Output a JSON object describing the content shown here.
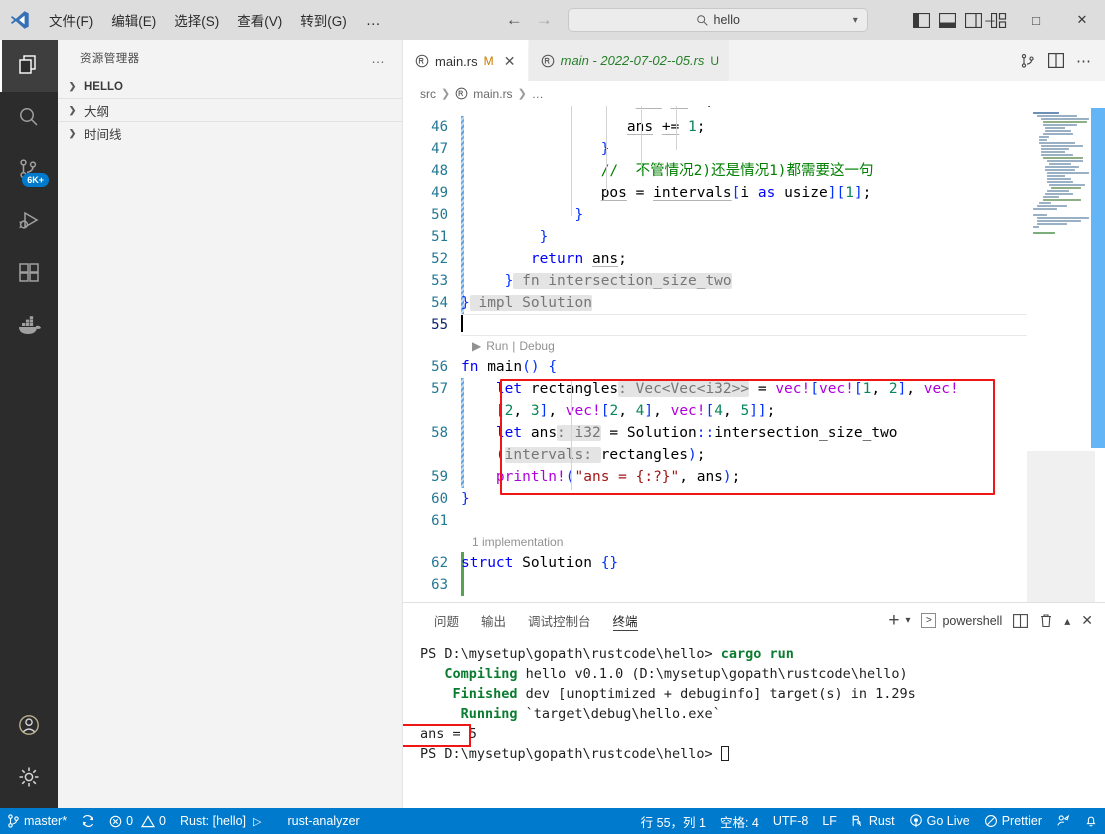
{
  "titlebar": {
    "logo_icon": "vscode-logo-icon",
    "menus": [
      {
        "label": "文件(F)"
      },
      {
        "label": "编辑(E)"
      },
      {
        "label": "选择(S)"
      },
      {
        "label": "查看(V)"
      },
      {
        "label": "转到(G)"
      }
    ],
    "more_label": "…",
    "back_icon": "arrow-left-icon",
    "forward_icon": "arrow-right-icon",
    "quickopen": {
      "search_icon": "search-icon",
      "value": "hello",
      "chevron_icon": "chevron-down-icon"
    },
    "layout_icons": [
      "toggle-primary-sidebar-icon",
      "toggle-panel-icon",
      "toggle-secondary-sidebar-icon",
      "customize-layout-icon"
    ],
    "window_controls": {
      "minimize": "─",
      "maximize": "□",
      "close": "✕"
    }
  },
  "activitybar": {
    "items": [
      {
        "name": "explorer",
        "icon": "files-icon",
        "active": true,
        "badge": ""
      },
      {
        "name": "search",
        "icon": "search-icon",
        "active": false,
        "badge": ""
      },
      {
        "name": "source-control",
        "icon": "source-control-icon",
        "active": false,
        "badge": "6K+"
      },
      {
        "name": "run-and-debug",
        "icon": "run-debug-icon",
        "active": false,
        "badge": ""
      },
      {
        "name": "extensions",
        "icon": "extensions-icon",
        "active": false,
        "badge": ""
      },
      {
        "name": "docker",
        "icon": "docker-icon",
        "active": false,
        "badge": ""
      }
    ],
    "bottom": [
      {
        "name": "accounts",
        "icon": "account-icon"
      },
      {
        "name": "manage",
        "icon": "gear-icon"
      }
    ]
  },
  "sidebar": {
    "title": "资源管理器",
    "more_icon": "ellipsis-icon",
    "sections": [
      {
        "label": "HELLO",
        "expanded": false,
        "bold": true
      },
      {
        "label": "大纲",
        "expanded": false,
        "bold": false
      },
      {
        "label": "时间线",
        "expanded": false,
        "bold": false
      }
    ]
  },
  "editor": {
    "tabs": [
      {
        "label": "main.rs",
        "badge": "M",
        "active": true,
        "preview": false,
        "icon": "rust-file-icon",
        "close_icon": "✕"
      },
      {
        "label": "main - 2022-07-02--05.rs",
        "badge": "U",
        "active": false,
        "preview": true,
        "icon": "rust-file-icon",
        "close_icon": ""
      }
    ],
    "tab_actions": [
      "split-in-group-icon",
      "split-editor-icon",
      "more-actions-icon"
    ],
    "breadcrumb": [
      "src",
      "main.rs",
      "…"
    ],
    "breadcrumb_file_icon": "rust-file-icon",
    "codelens": {
      "implementation": "1 implementation",
      "run": "Run",
      "separator": "|",
      "debug": "Debug",
      "play_icon": "play-icon"
    },
    "lines": [
      {
        "n": "46",
        "indent": 8,
        "text": "ans += 1;"
      },
      {
        "n": "47",
        "indent": 6,
        "text": "}"
      },
      {
        "n": "48",
        "indent": 6,
        "text": "//  不管情况2)还是情况1)都需要这一句"
      },
      {
        "n": "49",
        "indent": 6,
        "text": "pos = intervals[i as usize][1];"
      },
      {
        "n": "50",
        "indent": 5,
        "text": "}"
      },
      {
        "n": "51",
        "indent": 4,
        "text": "}"
      },
      {
        "n": "52",
        "indent": 3,
        "text": "return ans;"
      },
      {
        "n": "53",
        "indent": 2,
        "text": "} fn intersection_size_two"
      },
      {
        "n": "54",
        "indent": 0,
        "text": "} impl Solution"
      },
      {
        "n": "55",
        "indent": 0,
        "text": ""
      },
      {
        "n": "56",
        "indent": 0,
        "text": "fn main() {"
      },
      {
        "n": "57",
        "indent": 1,
        "text": "let rectangles: Vec<Vec<i32>> = vec![vec![1, 2], vec![2, 3], vec![2, 4], vec![4, 5]];"
      },
      {
        "n": "58",
        "indent": 1,
        "text": "let ans: i32 = Solution::intersection_size_two(intervals: rectangles);"
      },
      {
        "n": "59",
        "indent": 1,
        "text": "println!(\"ans = {:?}\", ans);"
      },
      {
        "n": "60",
        "indent": 0,
        "text": "}"
      },
      {
        "n": "61",
        "indent": 0,
        "text": ""
      },
      {
        "n": "62",
        "indent": 0,
        "text": "struct Solution {}"
      },
      {
        "n": "63",
        "indent": 0,
        "text": ""
      }
    ]
  },
  "panel": {
    "tabs": [
      {
        "label": "问题",
        "active": false
      },
      {
        "label": "输出",
        "active": false
      },
      {
        "label": "调试控制台",
        "active": false
      },
      {
        "label": "终端",
        "active": true
      }
    ],
    "actions": {
      "new_terminal_icon": "plus-icon",
      "new_terminal_dropdown_icon": "chevron-down-icon",
      "shell_icon": "terminal-icon",
      "shell_name": "powershell",
      "split_icon": "split-terminal-icon",
      "kill_icon": "trash-icon",
      "maximize_icon": "chevron-up-icon",
      "close_icon": "close-icon"
    },
    "terminal": {
      "lines": [
        {
          "type": "prompt",
          "prompt": "PS D:\\mysetup\\gopath\\rustcode\\hello>",
          "cmd": " cargo run"
        },
        {
          "type": "status",
          "indent": "   ",
          "label": "Compiling",
          "rest": " hello v0.1.0 (D:\\mysetup\\gopath\\rustcode\\hello)"
        },
        {
          "type": "status",
          "indent": "    ",
          "label": "Finished",
          "rest": " dev [unoptimized + debuginfo] target(s) in 1.29s"
        },
        {
          "type": "status",
          "indent": "     ",
          "label": "Running",
          "rest": " `target\\debug\\hello.exe`"
        },
        {
          "type": "out",
          "text": "ans = 5",
          "highlighted": true
        },
        {
          "type": "prompt",
          "prompt": "PS D:\\mysetup\\gopath\\rustcode\\hello>",
          "cmd": " ",
          "cursor": true
        }
      ]
    }
  },
  "statusbar": {
    "left": [
      {
        "name": "remote-branch",
        "icon": "git-branch-icon",
        "label": "master*"
      },
      {
        "name": "sync",
        "icon": "sync-icon",
        "label": ""
      },
      {
        "name": "problems",
        "icon": "error-warning-icon",
        "label": "0",
        "label2": "0"
      },
      {
        "name": "rust-target",
        "icon": "",
        "label": "Rust: [hello]",
        "trailing_icon": "play-icon"
      },
      {
        "name": "rust-analyzer",
        "icon": "",
        "label": "rust-analyzer"
      }
    ],
    "right": [
      {
        "name": "cursor-position",
        "label": "行 55，列 1"
      },
      {
        "name": "indentation",
        "label": "空格: 4"
      },
      {
        "name": "encoding",
        "label": "UTF-8"
      },
      {
        "name": "eol",
        "label": "LF"
      },
      {
        "name": "language-mode",
        "icon": "rust-lang-icon",
        "label": "Rust"
      },
      {
        "name": "go-live",
        "icon": "broadcast-icon",
        "label": "Go Live"
      },
      {
        "name": "prettier",
        "icon": "prettier-icon",
        "label": "Prettier"
      },
      {
        "name": "feedback",
        "icon": "feedback-icon",
        "label": ""
      },
      {
        "name": "notifications",
        "icon": "bell-icon",
        "label": ""
      }
    ]
  },
  "colors": {
    "accent": "#007acc",
    "titlebar_bg": "#dddddd",
    "sidebar_bg": "#f3f3f3",
    "activitybar_bg": "#2c2c2c",
    "editor_bg": "#ffffff",
    "highlight_box": "#f01616",
    "scrollbar": "#64b5f6"
  }
}
